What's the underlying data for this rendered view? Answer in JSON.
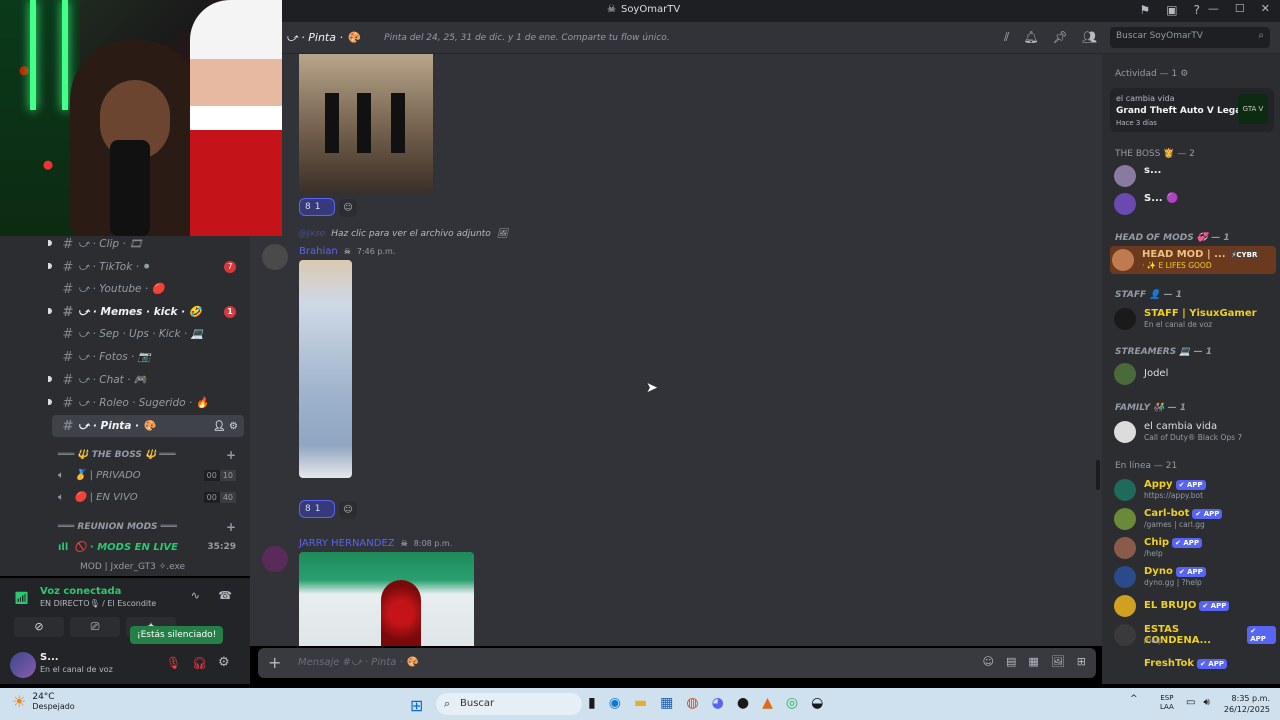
{
  "window": {
    "title": "SoyOmarTV"
  },
  "header": {
    "channel_name": "⤻ · Pinta · 🎨",
    "topic": "Pinta del 24, 25, 31 de dic. y 1 de ene. Comparte tu flow único.",
    "search_placeholder": "Buscar SoyOmarTV"
  },
  "sidebar": {
    "channels": [
      {
        "label": "⤻ · Clip · 🎞",
        "bold": false,
        "badge": ""
      },
      {
        "label": "⤻ · TikTok · ⚫",
        "bold": false,
        "badge": "7"
      },
      {
        "label": "⤻ · Youtube · 🔴",
        "bold": false,
        "badge": ""
      },
      {
        "label": "⤻ · Memes · kick · 🤣",
        "bold": true,
        "badge": "1"
      },
      {
        "label": "⤻ · Sep · Ups · Kick · 💻",
        "bold": false,
        "badge": ""
      },
      {
        "label": "⤻ · Fotos · 📷",
        "bold": false,
        "badge": ""
      },
      {
        "label": "⤻ · Chat · 🎮",
        "bold": false,
        "badge": ""
      },
      {
        "label": "⤻ · Roleo · Sugerido · 🔥",
        "bold": false,
        "badge": ""
      },
      {
        "label": "⤻ · Pinta · 🎨",
        "bold": true,
        "badge": ""
      }
    ],
    "categories": {
      "boss": "═══ 🔱 THE BOSS 🔱 ═══",
      "reunion": "═══ REUNION MODS ═══"
    },
    "voice": [
      {
        "label": "🥇 | PRIVADO",
        "count": "00",
        "max": "10"
      },
      {
        "label": "🔴 | EN VIVO",
        "count": "00",
        "max": "40"
      }
    ],
    "live_channel": {
      "label": "🚫 · MODS EN LIVE",
      "time": "35:29"
    },
    "live_user": "MOD | Jxder_GT3 ✧.exe"
  },
  "voice_panel": {
    "status": "Voz conectada",
    "sub": "EN DIRECTO🎙 / El Escondite",
    "toast": "¡Estás silenciado!"
  },
  "user_panel": {
    "name": "S...",
    "status": "En el canal de voz"
  },
  "chat": {
    "reaction_count": "1",
    "reaction_emoji": "8",
    "reply_text": "Haz clic para ver el archivo adjunto",
    "reply_name": "@Jxse",
    "msg2": {
      "author": "Brahian",
      "time": "7:46 p.m.",
      "color": "#5865f2"
    },
    "msg3": {
      "author": "JARRY HERNANDEZ",
      "time": "8:08 p.m.",
      "color": "#5865f2"
    }
  },
  "composer": {
    "placeholder": "Mensaje #⤻ · Pinta · 🎨"
  },
  "members": {
    "activity_header": "Actividad — 1",
    "activity": {
      "user": "el cambia vida",
      "game": "Grand Theft Auto V Legacy",
      "since": "Hace 3 días",
      "logo": "GTA V"
    },
    "groups": [
      {
        "header": "THE BOSS 👸 — 2"
      },
      {
        "header": "HEAD OF MODS 💞 — 1"
      },
      {
        "header": "STAFF 👤 — 1"
      },
      {
        "header": "STREAMERS 💻 — 1"
      },
      {
        "header": "FAMILY 👫 — 1"
      },
      {
        "header": "En línea — 21"
      }
    ],
    "boss": [
      {
        "name": "s...",
        "sub": "",
        "color": "#f2f3f5"
      },
      {
        "name": "S... 🟣",
        "sub": "",
        "color": "#f2f3f5"
      }
    ],
    "head_mod": {
      "name": "HEAD MOD | ...",
      "tag": "⚡CYBR",
      "sub": "· ✨ E LIFES GOOD",
      "color": "#f0c080"
    },
    "staff": {
      "name": "STAFF | YisuxGamer",
      "sub": "En el canal de voz",
      "color": "#f0d020"
    },
    "streamer": {
      "name": "Jodel",
      "color": "#dbdee1"
    },
    "family": {
      "name": "el cambia vida",
      "sub": "Call of Duty® Black Ops 7",
      "color": "#dbdee1"
    },
    "online": [
      {
        "name": "Appy",
        "tag": "✔ APP",
        "sub": "https://appy.bot",
        "color": "#f0d020"
      },
      {
        "name": "Carl-bot",
        "tag": "✔ APP",
        "sub": "/games | carl.gg",
        "color": "#f0d020"
      },
      {
        "name": "Chip",
        "tag": "✔ APP",
        "sub": "/help",
        "color": "#f0d020"
      },
      {
        "name": "Dyno",
        "tag": "✔ APP",
        "sub": "dyno.gg | ?help",
        "color": "#f0d020"
      },
      {
        "name": "EL BRUJO",
        "tag": "✔ APP",
        "sub": "",
        "color": "#f0d020"
      },
      {
        "name": "ESTAS CONDENA...",
        "tag": "✔ APP",
        "sub": "/help",
        "color": "#f0d020"
      },
      {
        "name": "FreshTok",
        "tag": "✔ APP",
        "sub": "",
        "color": "#f0d020"
      }
    ]
  },
  "taskbar": {
    "temp": "24°C",
    "weather": "Despejado",
    "search": "Buscar",
    "lang1": "ESP",
    "lang2": "LAA",
    "time": "8:35 p.m.",
    "date": "26/12/2025"
  }
}
